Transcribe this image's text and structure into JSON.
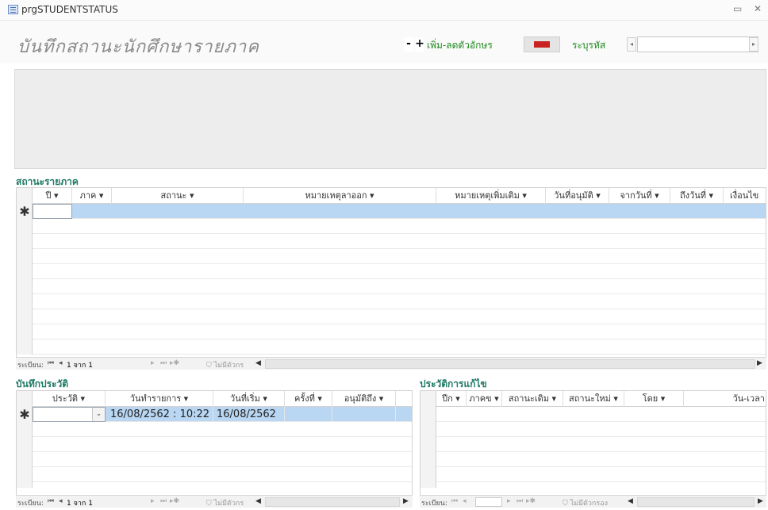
{
  "window": {
    "title": "prgSTUDENTSTATUS",
    "minimize_glyph": "▭",
    "close_glyph": "✕"
  },
  "header": {
    "title": "บันทึกสถานะนักศึกษารายภาค",
    "minus_label": "-",
    "plus_label": "+",
    "font_size_label": "เพิ่ม-ลดตัวอักษร",
    "specify_id_label": "ระบุรหัส",
    "id_value": ""
  },
  "term_status": {
    "section_label": "สถานะรายภาค",
    "columns": [
      "ปี",
      "ภาค",
      "สถานะ",
      "หมายเหตุลาออก",
      "หมายเหตุเพิ่มเติม",
      "วันที่อนุมัติ",
      "จากวันที่",
      "ถึงวันที่",
      "เงื่อนไข"
    ],
    "new_row_marker": "✱",
    "nav": {
      "record_label": "ระเบียน:",
      "position": "1 จาก 1",
      "filter_label": "ไม่มีตัวกร"
    }
  },
  "history_record": {
    "section_label": "บันทึกประวัติ",
    "columns": [
      "ประวัติ",
      "วันทำรายการ",
      "วันที่เริ่ม",
      "ครั้งที่",
      "อนุมัติถึง"
    ],
    "new_row_marker": "✱",
    "row": {
      "history": "",
      "entry_date": "16/08/2562 : 10:22",
      "start_date": "16/08/2562",
      "count": "",
      "approved_until": ""
    },
    "nav": {
      "record_label": "ระเบียน:",
      "position": "1 จาก 1",
      "filter_label": "ไม่มีตัวกร"
    }
  },
  "edit_history": {
    "section_label": "ประวัติการแก้ไข",
    "columns": [
      "ปีก",
      "ภาคข",
      "สถานะเดิม",
      "สถานะใหม่",
      "โดย",
      "วัน-เวลา"
    ],
    "nav": {
      "record_label": "ระเบียน:",
      "filter_label": "ไม่มีตัวกรอง"
    }
  },
  "colors": {
    "accent_green": "#1f8a1f",
    "section_teal": "#1f7a66",
    "selected_row": "#b9d6f2",
    "flag_red": "#c92222"
  }
}
